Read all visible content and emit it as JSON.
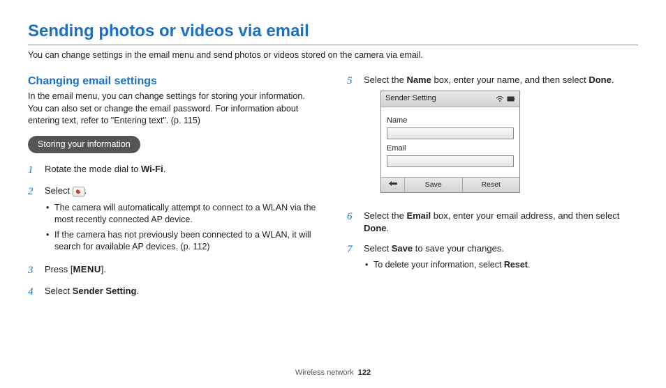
{
  "title": "Sending photos or videos via email",
  "intro": "You can change settings in the email menu and send photos or videos stored on the camera via email.",
  "subhead": "Changing email settings",
  "subintro": "In the email menu, you can change settings for storing your information. You can also set or change the email password. For information about entering text, refer to \"Entering text\". (p. 115)",
  "pill": "Storing your information",
  "steps": {
    "s1_pre": "Rotate the mode dial to ",
    "s1_token": "Wi-Fi",
    "s1_post": ".",
    "s2_pre": "Select ",
    "s2_post": ".",
    "s2_sub1": "The camera will automatically attempt to connect to a WLAN via the most recently connected AP device.",
    "s2_sub2": "If the camera has not previously been connected to a WLAN, it will search for available AP devices. (p. 112)",
    "s3_pre": "Press [",
    "s3_token": "MENU",
    "s3_post": "].",
    "s4_pre": "Select ",
    "s4_bold": "Sender Setting",
    "s4_post": ".",
    "s5_pre": "Select the ",
    "s5_bold1": "Name",
    "s5_mid": " box, enter your name, and then select ",
    "s5_bold2": "Done",
    "s5_post": ".",
    "s6_pre": "Select the ",
    "s6_bold1": "Email",
    "s6_mid": " box, enter your email address, and then select ",
    "s6_bold2": "Done",
    "s6_post": ".",
    "s7_pre": "Select ",
    "s7_bold": "Save",
    "s7_post": " to save your changes.",
    "s7_sub_pre": "To delete your information, select ",
    "s7_sub_bold": "Reset",
    "s7_sub_post": "."
  },
  "panel": {
    "title": "Sender Setting",
    "name_label": "Name",
    "email_label": "Email",
    "save": "Save",
    "reset": "Reset"
  },
  "footer": {
    "section": "Wireless network",
    "page": "122"
  }
}
